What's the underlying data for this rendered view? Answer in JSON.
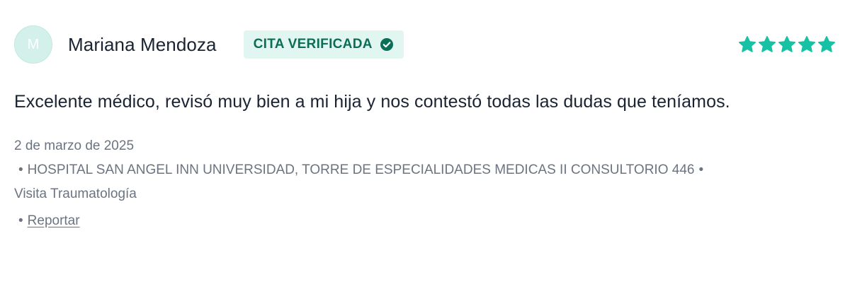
{
  "review": {
    "avatar_initial": "M",
    "author_name": "Mariana Mendoza",
    "badge_label": "CITA VERIFICADA",
    "rating": 5,
    "rating_max": 5,
    "text": "Excelente médico, revisó muy bien a mi hija y nos contestó todas las dudas que teníamos.",
    "date": "2 de marzo de 2025",
    "bullet": "•",
    "location": "HOSPITAL SAN ANGEL INN UNIVERSIDAD, TORRE DE ESPECIALIDADES MEDICAS II CONSULTORIO 446",
    "visit_type": "Visita Traumatología",
    "report_label": "Reportar"
  },
  "colors": {
    "star": "#16c2a3",
    "badge_bg": "#e2f6f1",
    "badge_text": "#0b6e57",
    "avatar_bg": "#d3f0ea",
    "text_primary": "#1a2332",
    "text_muted": "#6b7480"
  },
  "icons": {
    "badge_icon": "check-circle-icon",
    "rating_icon": "star-icon"
  }
}
